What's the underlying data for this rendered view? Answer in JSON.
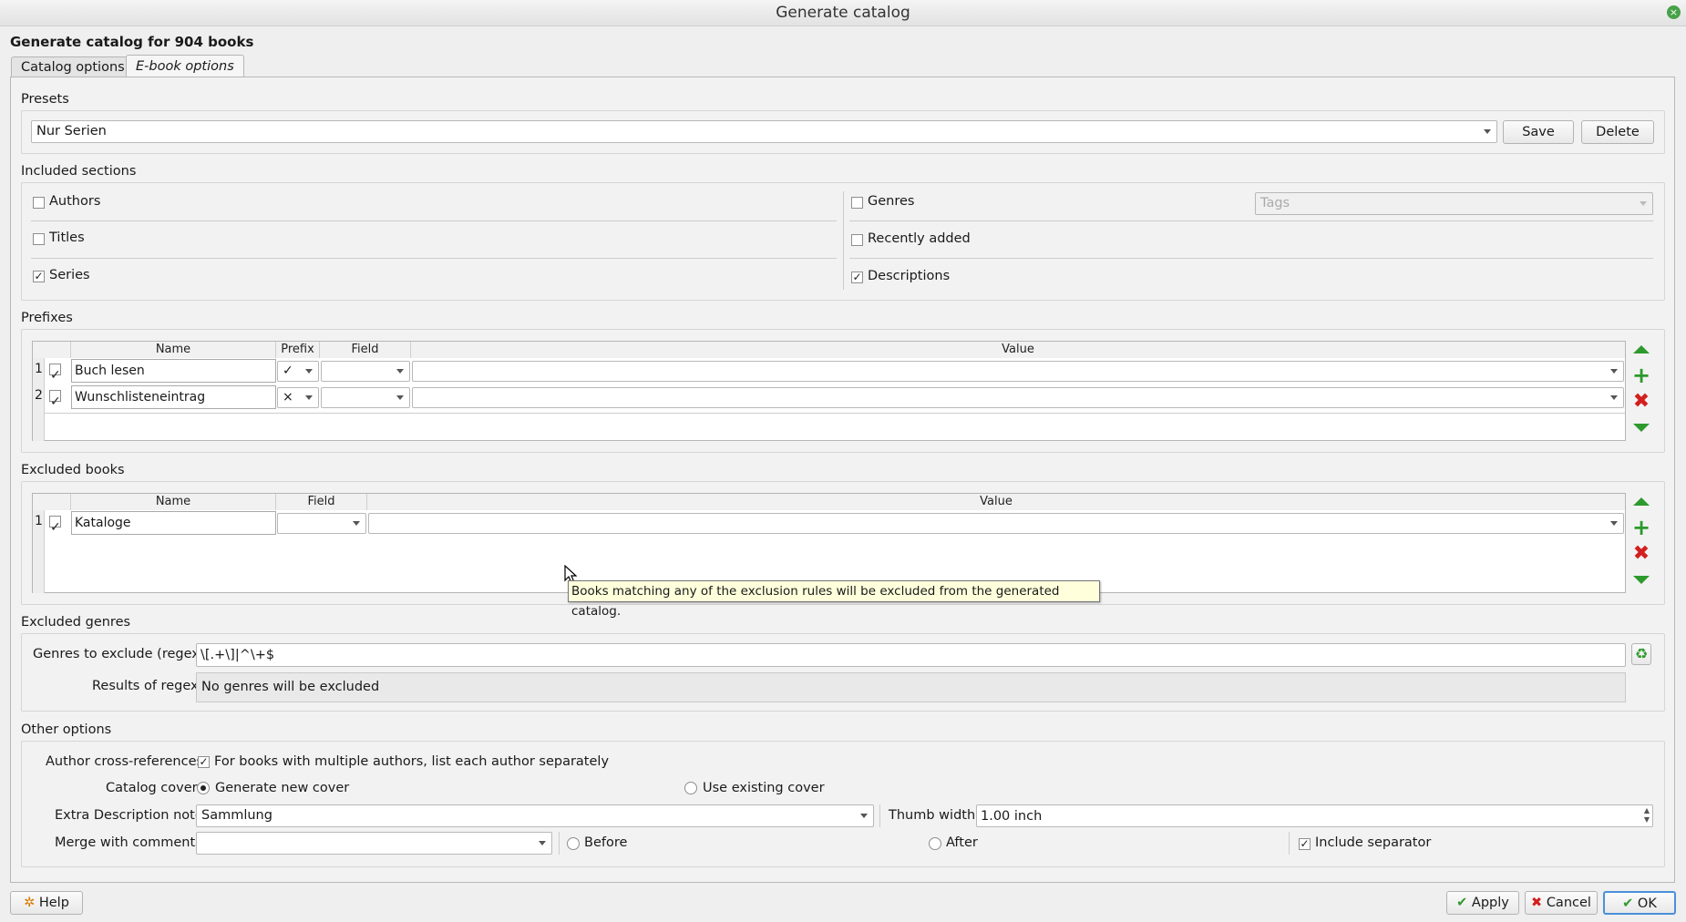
{
  "window": {
    "title": "Generate catalog"
  },
  "heading": "Generate catalog for 904 books",
  "tabs": [
    {
      "label": "Catalog options",
      "active": false
    },
    {
      "label": "E-book options",
      "active": true
    }
  ],
  "presets": {
    "title": "Presets",
    "selected": "Nur Serien",
    "save_label": "Save",
    "delete_label": "Delete"
  },
  "included_sections": {
    "title": "Included sections",
    "authors": {
      "label": "Authors",
      "checked": false
    },
    "titles": {
      "label": "Titles",
      "checked": false
    },
    "series": {
      "label": "Series",
      "checked": true
    },
    "genres": {
      "label": "Genres",
      "checked": false
    },
    "genres_source_placeholder": "Tags",
    "recently_added": {
      "label": "Recently added",
      "checked": false
    },
    "descriptions": {
      "label": "Descriptions",
      "checked": true
    }
  },
  "prefixes": {
    "title": "Prefixes",
    "columns": [
      "Name",
      "Prefix",
      "Field",
      "Value"
    ],
    "rows": [
      {
        "num": "1",
        "enabled": "✓",
        "name": "Buch lesen",
        "prefix": "✓",
        "field": "",
        "value": ""
      },
      {
        "num": "2",
        "enabled": "✓",
        "name": "Wunschlisteneintrag",
        "prefix": "×",
        "field": "",
        "value": ""
      }
    ]
  },
  "excluded_books": {
    "title": "Excluded books",
    "columns": [
      "Name",
      "Field",
      "Value"
    ],
    "rows": [
      {
        "num": "1",
        "enabled": "✓",
        "name": "Kataloge",
        "field": "",
        "value": ""
      }
    ]
  },
  "tooltip": "Books matching any of the exclusion rules will be excluded from the generated catalog.",
  "excluded_genres": {
    "title": "Excluded genres",
    "regex_label": "Genres to exclude (regex):",
    "regex_value": "\\[.+\\]|^\\+$",
    "results_label": "Results of regex:",
    "results_value": "No genres will be excluded"
  },
  "other_options": {
    "title": "Other options",
    "author_xref_label": "Author cross-references:",
    "author_xref_option": "For books with multiple authors, list each author separately",
    "catalog_cover_label": "Catalog cover:",
    "generate_new_cover": "Generate new cover",
    "use_existing_cover": "Use existing cover",
    "extra_desc_label": "Extra Description note:",
    "extra_desc_value": "Sammlung",
    "thumb_width_label": "Thumb width:",
    "thumb_width_value": "1.00 inch",
    "merge_label": "Merge with comments:",
    "merge_value": "",
    "before_label": "Before",
    "after_label": "After",
    "include_separator_label": "Include separator"
  },
  "footer": {
    "help": "Help",
    "apply": "Apply",
    "cancel": "Cancel",
    "ok": "OK"
  },
  "colors": {
    "accent_green": "#2e9a2e",
    "danger_red": "#d21f1f",
    "tooltip_bg": "#ffffdc"
  }
}
